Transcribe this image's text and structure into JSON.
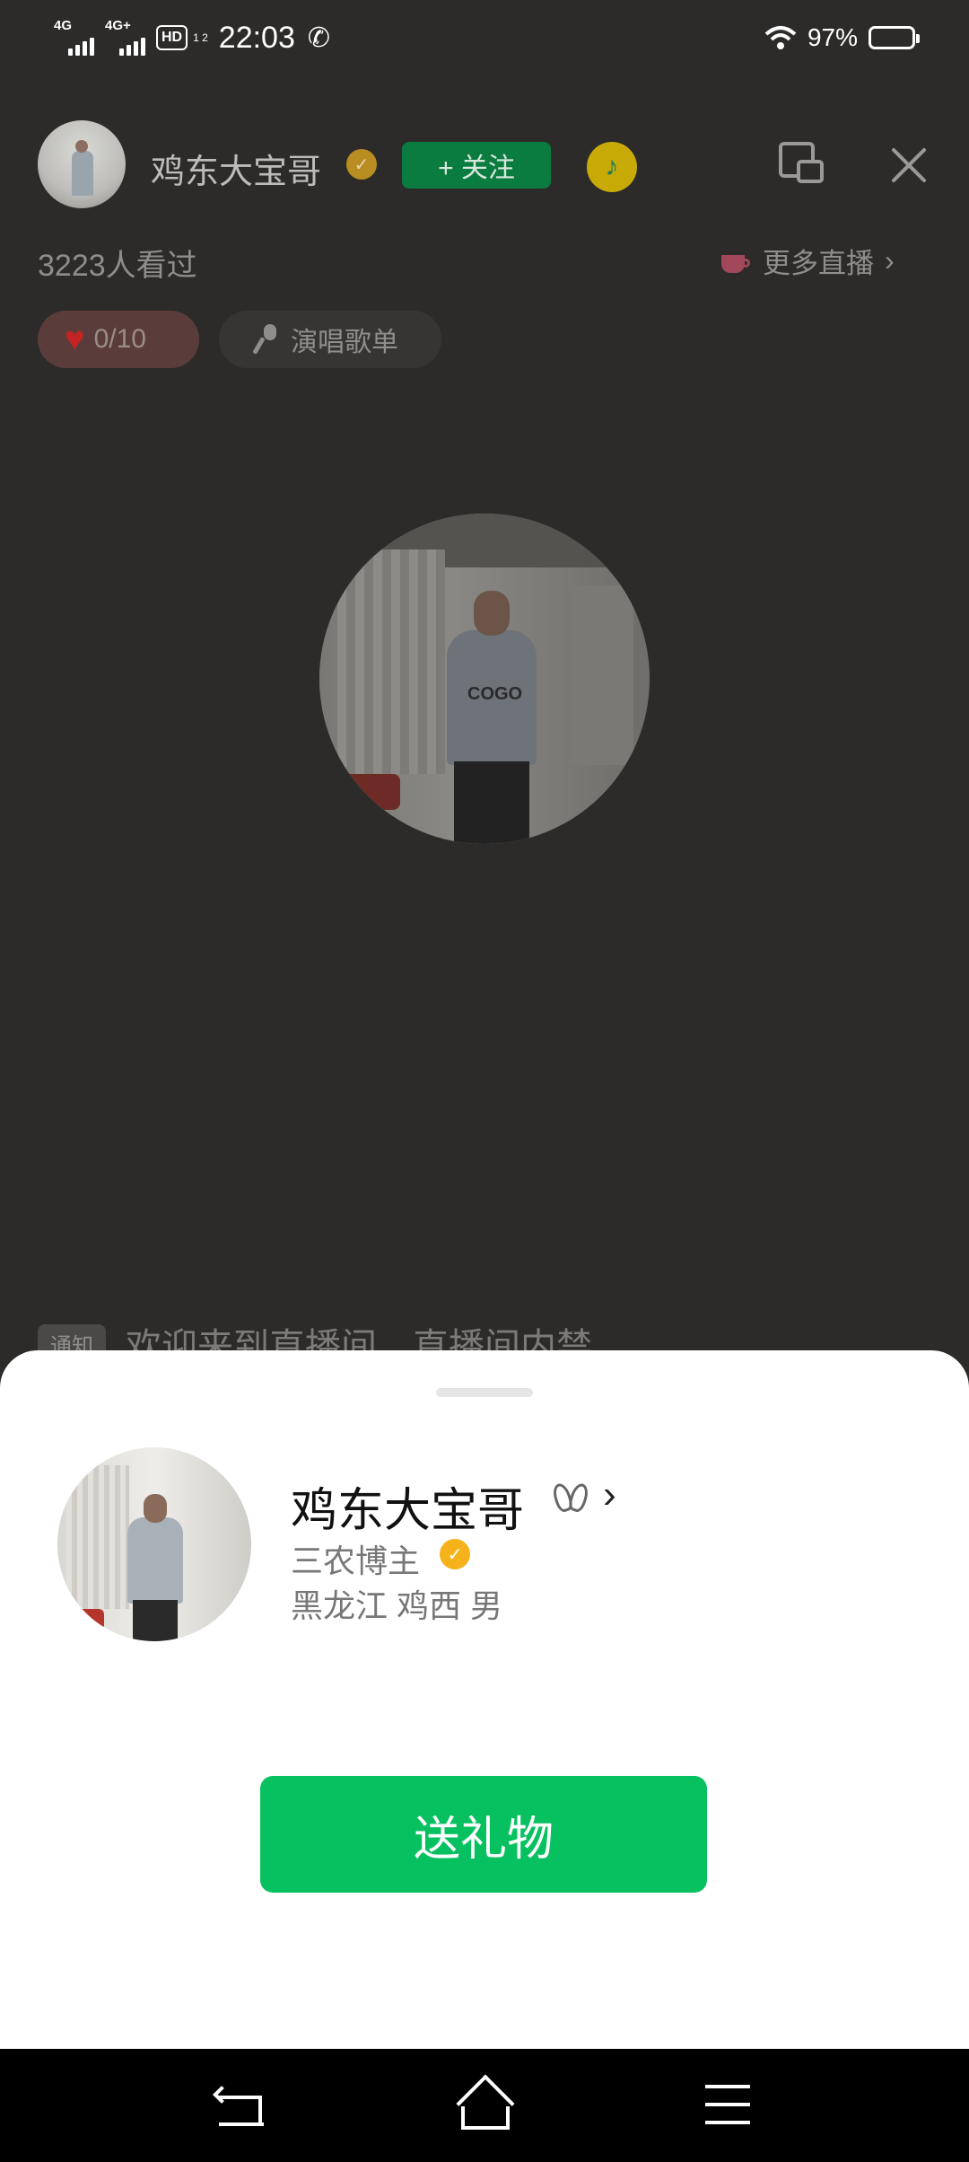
{
  "status_bar": {
    "network1": "4G",
    "network2": "4G+",
    "hd": "HD",
    "hd_sub": "1 2",
    "time": "22:03",
    "battery": "97%",
    "battery_level": 0.97,
    "icons": [
      "signal-icon",
      "phone-call-icon",
      "wifi-icon",
      "battery-icon"
    ]
  },
  "live": {
    "host_name": "鸡东大宝哥",
    "follow_label": "+ 关注",
    "viewers": "3223人看过",
    "more_live": "更多直播",
    "likes": "0/10",
    "songs": "演唱歌单",
    "notice_tag": "通知",
    "notice_text": "欢迎来到直播间，直播间内禁"
  },
  "profile": {
    "name": "鸡东大宝哥",
    "title": "三农博主",
    "location": "黑龙江 鸡西  男",
    "gift_button": "送礼物"
  },
  "colors": {
    "primary_green": "#07c160",
    "verify_gold": "#f6b21b",
    "heart_red": "#c42323"
  }
}
